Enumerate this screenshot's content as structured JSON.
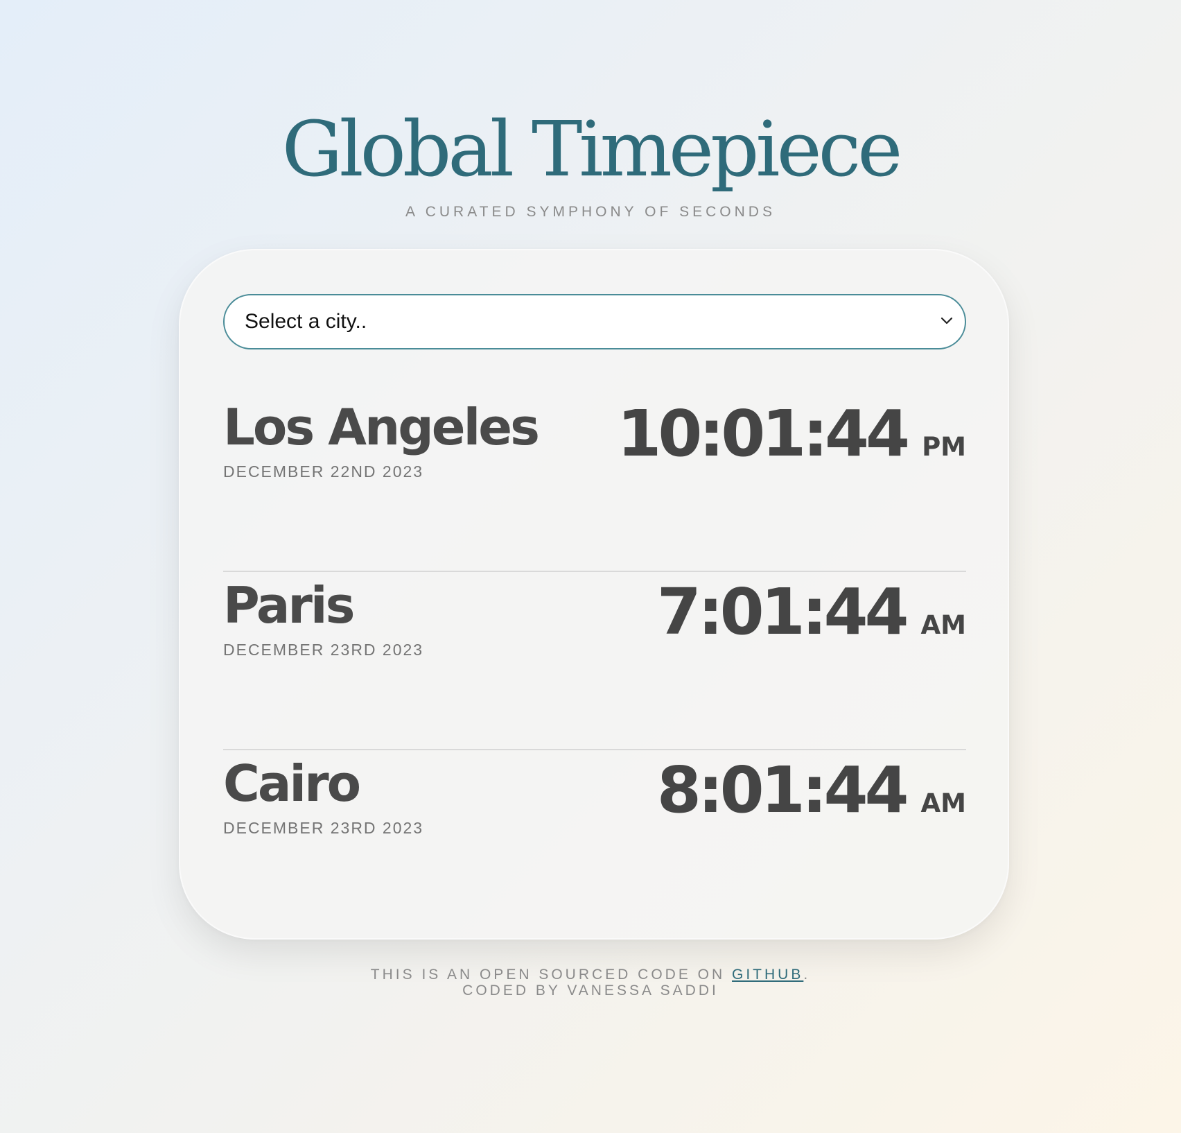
{
  "header": {
    "title": "Global Timepiece",
    "subtitle": "A CURATED SYMPHONY OF SECONDS"
  },
  "city_select": {
    "selected_label": "Select a city..",
    "icon": "chevron-down-icon"
  },
  "cities": [
    {
      "name": "Los Angeles",
      "date": "DECEMBER 22ND 2023",
      "time": "10:01:44",
      "period": "PM"
    },
    {
      "name": "Paris",
      "date": "DECEMBER 23RD 2023",
      "time": "7:01:44",
      "period": "AM"
    },
    {
      "name": "Cairo",
      "date": "DECEMBER 23RD 2023",
      "time": "8:01:44",
      "period": "AM"
    }
  ],
  "footer": {
    "line1_prefix": "THIS IS AN OPEN SOURCED CODE ON ",
    "github_link": "GITHUB",
    "line1_suffix": ".",
    "line2": "CODED BY VANESSA SADDI"
  },
  "colors": {
    "accent": "#2f6b7a",
    "text_dark": "#454545",
    "text_muted": "#8a8a8a"
  }
}
